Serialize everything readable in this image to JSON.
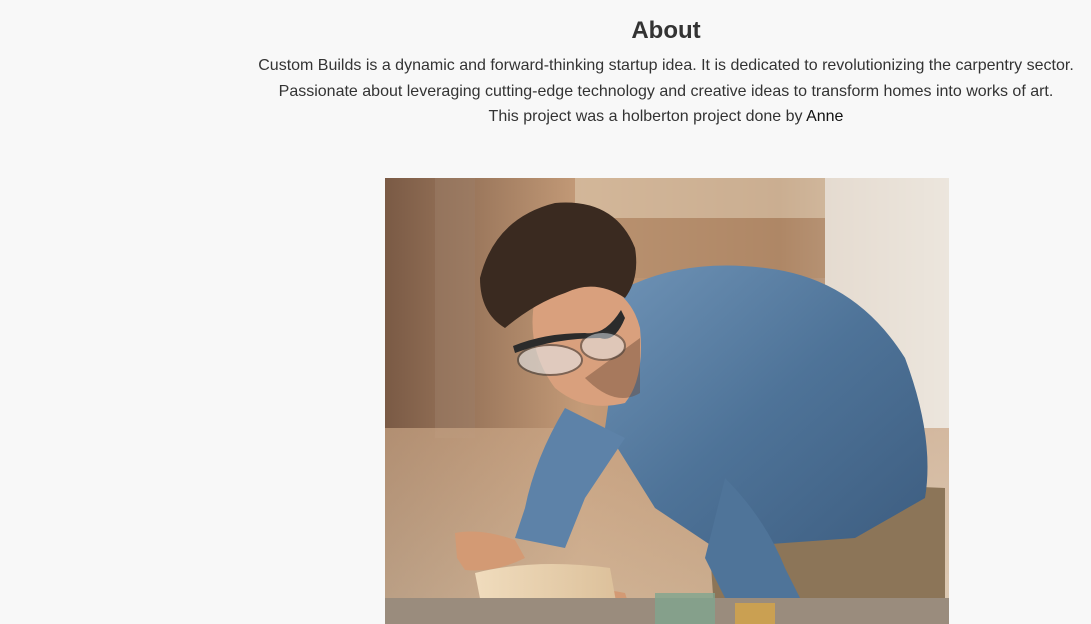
{
  "about": {
    "title": "About",
    "line1": "Custom Builds is a dynamic and forward-thinking startup idea. It is dedicated to revolutionizing the carpentry sector.",
    "line2": "Passionate about leveraging cutting-edge technology and creative ideas to transform homes into works of art.",
    "line3_prefix": "This project was a holberton project done by ",
    "author": "Anne"
  },
  "image": {
    "subject": "carpenter sanding wood plank wearing safety glasses and denim shirt",
    "colors": {
      "background_warm": "#b08a66",
      "shirt_denim": "#5a7fa3",
      "hair": "#3a2a20",
      "skin": "#d9a07d",
      "wood": "#e8d2b0"
    }
  }
}
